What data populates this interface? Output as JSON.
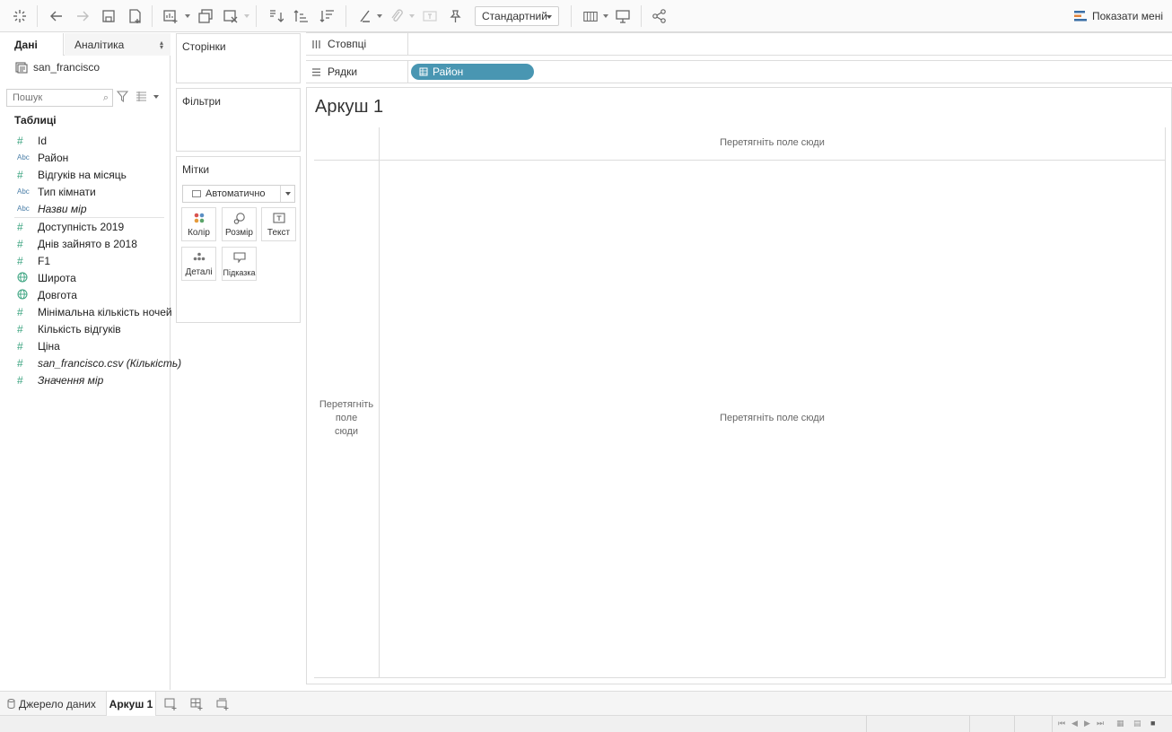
{
  "toolbar": {
    "fit_value": "Стандартний",
    "show_me_label": "Показати мені"
  },
  "data_pane": {
    "tab_data": "Дані",
    "tab_analytics": "Аналітика",
    "datasource": "san_francisco",
    "search_placeholder": "Пошук",
    "tables_header": "Таблиці",
    "dimensions": [
      {
        "type": "number",
        "label": "Id"
      },
      {
        "type": "text",
        "type_label": "Abc",
        "label": "Район"
      },
      {
        "type": "number",
        "label": "Відгуків на місяць"
      },
      {
        "type": "text",
        "type_label": "Abc",
        "label": "Тип кімнати"
      },
      {
        "type": "text",
        "type_label": "Abc",
        "label": "Назви мір"
      }
    ],
    "measures": [
      {
        "type": "number",
        "label": "Доступність 2019"
      },
      {
        "type": "number",
        "label": "Днів зайнято в 2018"
      },
      {
        "type": "number",
        "label": "F1"
      },
      {
        "type": "geo",
        "label": "Широта"
      },
      {
        "type": "geo",
        "label": "Довгота"
      },
      {
        "type": "number",
        "label": "Мінімальна кількість ночей"
      },
      {
        "type": "number",
        "label": "Кількість відгуків"
      },
      {
        "type": "number",
        "label": "Ціна"
      },
      {
        "type": "number",
        "label": "san_francisco.csv (Кількість)"
      },
      {
        "type": "number",
        "label": "Значення мір"
      }
    ]
  },
  "shelves": {
    "pages": "Сторінки",
    "filters": "Фільтри",
    "marks": "Мітки",
    "marks_type": "Автоматично",
    "mark_buttons": {
      "color": "Колір",
      "size": "Розмір",
      "text": "Текст",
      "detail": "Деталі",
      "tooltip": "Підказка"
    },
    "columns": "Стовпці",
    "rows": "Рядки",
    "rows_pill": "Район"
  },
  "view": {
    "sheet_title": "Аркуш 1",
    "drop_field_here": "Перетягніть поле сюди",
    "drop_rows_lines": [
      "Перетягніть",
      "поле",
      "сюди"
    ]
  },
  "bottom_tabs": {
    "data_source": "Джерело даних",
    "sheet1": "Аркуш 1"
  },
  "colors": {
    "pill": "#4996b2",
    "dimension_type": "#4b7fa8",
    "measure_type": "#3aa37f"
  }
}
